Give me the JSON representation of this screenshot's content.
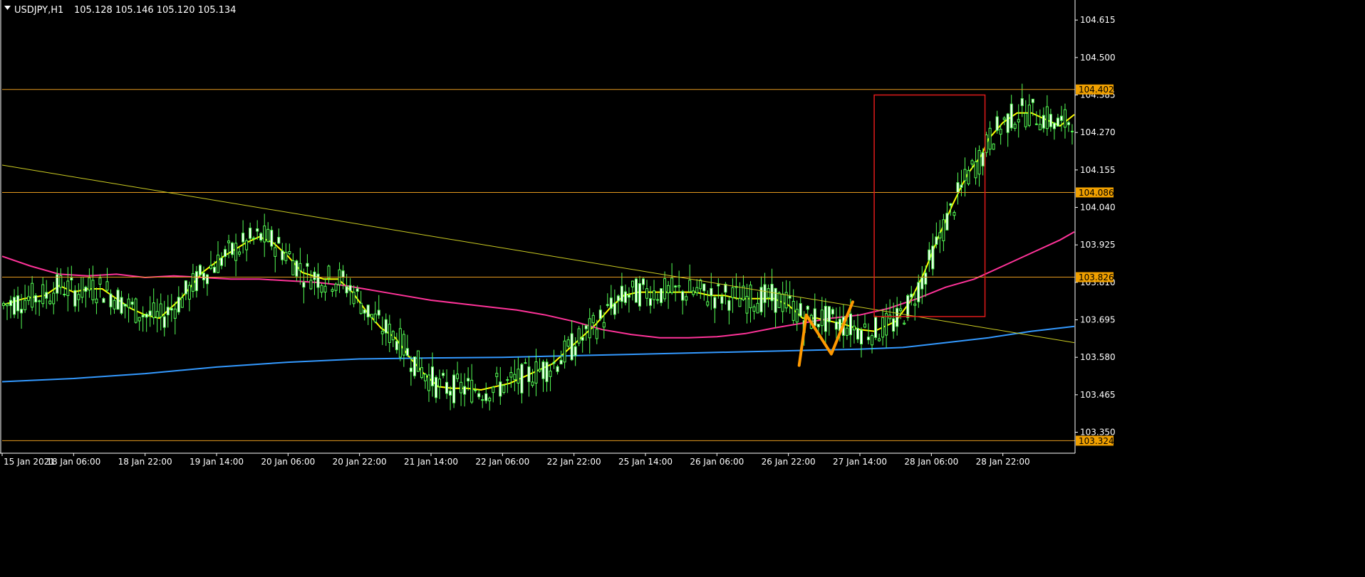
{
  "header": {
    "symbol_label": "USDJPY,H1",
    "ohlc": "105.128 105.146 105.120 105.134"
  },
  "colors": {
    "background": "#000000",
    "axis": "#ffffff",
    "bull_candle": "#55ff55",
    "bull_fill": "#000000",
    "bear_fill": "#ffffff",
    "ma_fast": "#ffff00",
    "ma_mid": "#ff3399",
    "ma_slow": "#3399ff",
    "hline": "#e69a1f",
    "hline_tag": "#f0a000",
    "trendline": "#cccc22",
    "rect": "#e01b1b",
    "pattern": "#ff9900"
  },
  "chart_data": {
    "type": "candlestick",
    "title": "USDJPY,H1",
    "y_range": [
      103.29,
      104.67
    ],
    "y_ticks": [
      "104.615",
      "104.500",
      "104.385",
      "104.270",
      "104.155",
      "104.040",
      "103.925",
      "103.810",
      "103.695",
      "103.580",
      "103.465",
      "103.350"
    ],
    "x_ticks": [
      "15 Jan 2021",
      "18 Jan 06:00",
      "18 Jan 22:00",
      "19 Jan 14:00",
      "20 Jan 06:00",
      "20 Jan 22:00",
      "21 Jan 14:00",
      "22 Jan 06:00",
      "22 Jan 22:00",
      "25 Jan 14:00",
      "26 Jan 06:00",
      "26 Jan 22:00",
      "27 Jan 14:00",
      "28 Jan 06:00",
      "28 Jan 22:00"
    ],
    "x_range": [
      0,
      150
    ],
    "price_levels": [
      {
        "price": 104.402,
        "label": "104.402"
      },
      {
        "price": 104.086,
        "label": "104.086"
      },
      {
        "price": 103.826,
        "label": "103.826"
      },
      {
        "price": 103.324,
        "label": "103.324"
      }
    ],
    "trendline": {
      "x": [
        0,
        150
      ],
      "y": [
        104.17,
        103.625
      ]
    },
    "highlight_box": {
      "x": [
        122,
        137.5
      ],
      "y": [
        103.705,
        104.385
      ]
    },
    "pattern_line": {
      "x": [
        111.5,
        112.5,
        116,
        119
      ],
      "y": [
        103.555,
        103.71,
        103.59,
        103.75
      ]
    },
    "moving_averages": [
      {
        "key": "ma_fast",
        "points": [
          [
            0,
            103.74
          ],
          [
            3,
            103.76
          ],
          [
            6,
            103.77
          ],
          [
            8,
            103.8
          ],
          [
            10,
            103.78
          ],
          [
            12,
            103.79
          ],
          [
            14,
            103.79
          ],
          [
            16,
            103.76
          ],
          [
            18,
            103.73
          ],
          [
            20,
            103.71
          ],
          [
            22,
            103.7
          ],
          [
            23,
            103.72
          ],
          [
            25,
            103.76
          ],
          [
            28,
            103.84
          ],
          [
            31,
            103.89
          ],
          [
            34,
            103.93
          ],
          [
            36,
            103.95
          ],
          [
            38,
            103.93
          ],
          [
            40,
            103.89
          ],
          [
            42,
            103.84
          ],
          [
            45,
            103.82
          ],
          [
            47,
            103.82
          ],
          [
            49,
            103.78
          ],
          [
            51,
            103.72
          ],
          [
            53,
            103.67
          ],
          [
            55,
            103.64
          ],
          [
            57,
            103.58
          ],
          [
            59,
            103.53
          ],
          [
            61,
            103.49
          ],
          [
            63,
            103.485
          ],
          [
            65,
            103.485
          ],
          [
            67,
            103.48
          ],
          [
            69,
            103.49
          ],
          [
            71,
            103.5
          ],
          [
            73,
            103.52
          ],
          [
            75,
            103.54
          ],
          [
            77,
            103.56
          ],
          [
            79,
            103.6
          ],
          [
            81,
            103.64
          ],
          [
            83,
            103.68
          ],
          [
            85,
            103.73
          ],
          [
            87,
            103.77
          ],
          [
            89,
            103.78
          ],
          [
            91,
            103.78
          ],
          [
            93,
            103.78
          ],
          [
            95,
            103.78
          ],
          [
            97,
            103.78
          ],
          [
            99,
            103.77
          ],
          [
            101,
            103.77
          ],
          [
            103,
            103.76
          ],
          [
            105,
            103.76
          ],
          [
            108,
            103.76
          ],
          [
            110,
            103.74
          ],
          [
            112,
            103.7
          ],
          [
            114,
            103.7
          ],
          [
            116,
            103.69
          ],
          [
            118,
            103.68
          ],
          [
            120,
            103.665
          ],
          [
            122,
            103.66
          ],
          [
            123,
            103.67
          ],
          [
            125,
            103.69
          ],
          [
            127,
            103.75
          ],
          [
            129,
            103.84
          ],
          [
            131,
            103.95
          ],
          [
            133,
            104.05
          ],
          [
            135,
            104.14
          ],
          [
            137,
            104.2
          ],
          [
            138,
            104.25
          ],
          [
            140,
            104.3
          ],
          [
            142,
            104.33
          ],
          [
            144,
            104.33
          ],
          [
            146,
            104.31
          ],
          [
            148,
            104.29
          ],
          [
            150,
            104.325
          ]
        ]
      },
      {
        "key": "ma_mid",
        "points": [
          [
            0,
            103.89
          ],
          [
            4,
            103.86
          ],
          [
            8,
            103.835
          ],
          [
            12,
            103.83
          ],
          [
            16,
            103.835
          ],
          [
            20,
            103.825
          ],
          [
            24,
            103.83
          ],
          [
            28,
            103.825
          ],
          [
            32,
            103.82
          ],
          [
            36,
            103.82
          ],
          [
            40,
            103.815
          ],
          [
            44,
            103.81
          ],
          [
            48,
            103.8
          ],
          [
            52,
            103.785
          ],
          [
            56,
            103.77
          ],
          [
            60,
            103.755
          ],
          [
            64,
            103.745
          ],
          [
            68,
            103.735
          ],
          [
            72,
            103.725
          ],
          [
            76,
            103.71
          ],
          [
            80,
            103.69
          ],
          [
            84,
            103.665
          ],
          [
            88,
            103.65
          ],
          [
            92,
            103.64
          ],
          [
            96,
            103.64
          ],
          [
            100,
            103.643
          ],
          [
            104,
            103.653
          ],
          [
            108,
            103.67
          ],
          [
            112,
            103.685
          ],
          [
            116,
            103.7
          ],
          [
            120,
            103.71
          ],
          [
            124,
            103.73
          ],
          [
            128,
            103.76
          ],
          [
            132,
            103.795
          ],
          [
            136,
            103.82
          ],
          [
            140,
            103.86
          ],
          [
            144,
            103.9
          ],
          [
            148,
            103.94
          ],
          [
            150,
            103.965
          ]
        ]
      },
      {
        "key": "ma_slow",
        "points": [
          [
            0,
            103.505
          ],
          [
            10,
            103.515
          ],
          [
            20,
            103.53
          ],
          [
            30,
            103.55
          ],
          [
            40,
            103.565
          ],
          [
            50,
            103.575
          ],
          [
            60,
            103.578
          ],
          [
            70,
            103.58
          ],
          [
            80,
            103.585
          ],
          [
            90,
            103.59
          ],
          [
            100,
            103.595
          ],
          [
            110,
            103.6
          ],
          [
            120,
            103.605
          ],
          [
            126,
            103.61
          ],
          [
            132,
            103.625
          ],
          [
            138,
            103.64
          ],
          [
            144,
            103.66
          ],
          [
            150,
            103.675
          ]
        ]
      }
    ]
  }
}
